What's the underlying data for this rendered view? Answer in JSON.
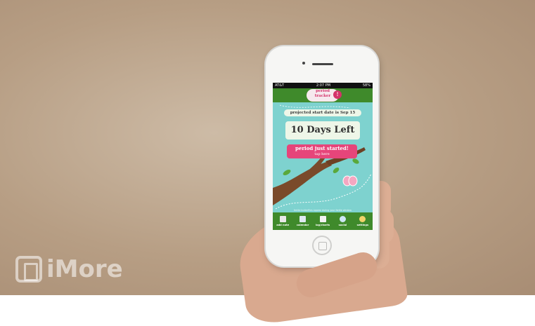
{
  "watermark": {
    "text": "iMore"
  },
  "status_bar": {
    "carrier": "AT&T",
    "time": "2:07 PM",
    "battery": "58%"
  },
  "app": {
    "logo_line1": "period",
    "logo_line2": "tracker",
    "logo_badge": "!",
    "projected_text": "projected start date is Sep 15",
    "days_left": "10 Days Left",
    "started_label": "period just started!",
    "started_sub": "tap here",
    "fertile_note": "fertile butterflies appear during your fertile window"
  },
  "tabs": [
    {
      "label": "add note",
      "icon": "note-icon",
      "color": "#e8e8e8"
    },
    {
      "label": "calendar",
      "icon": "calendar-icon",
      "color": "#dfe9f2"
    },
    {
      "label": "log/charts",
      "icon": "chart-icon",
      "color": "#f2f2f2"
    },
    {
      "label": "social",
      "icon": "speech-bubble-icon",
      "color": "#cde7f5"
    },
    {
      "label": "settings",
      "icon": "gear-icon",
      "color": "#f0d36a"
    }
  ],
  "colors": {
    "header_green": "#3f8a2b",
    "sky": "#7ed2cf",
    "accent_pink": "#e6457a"
  }
}
